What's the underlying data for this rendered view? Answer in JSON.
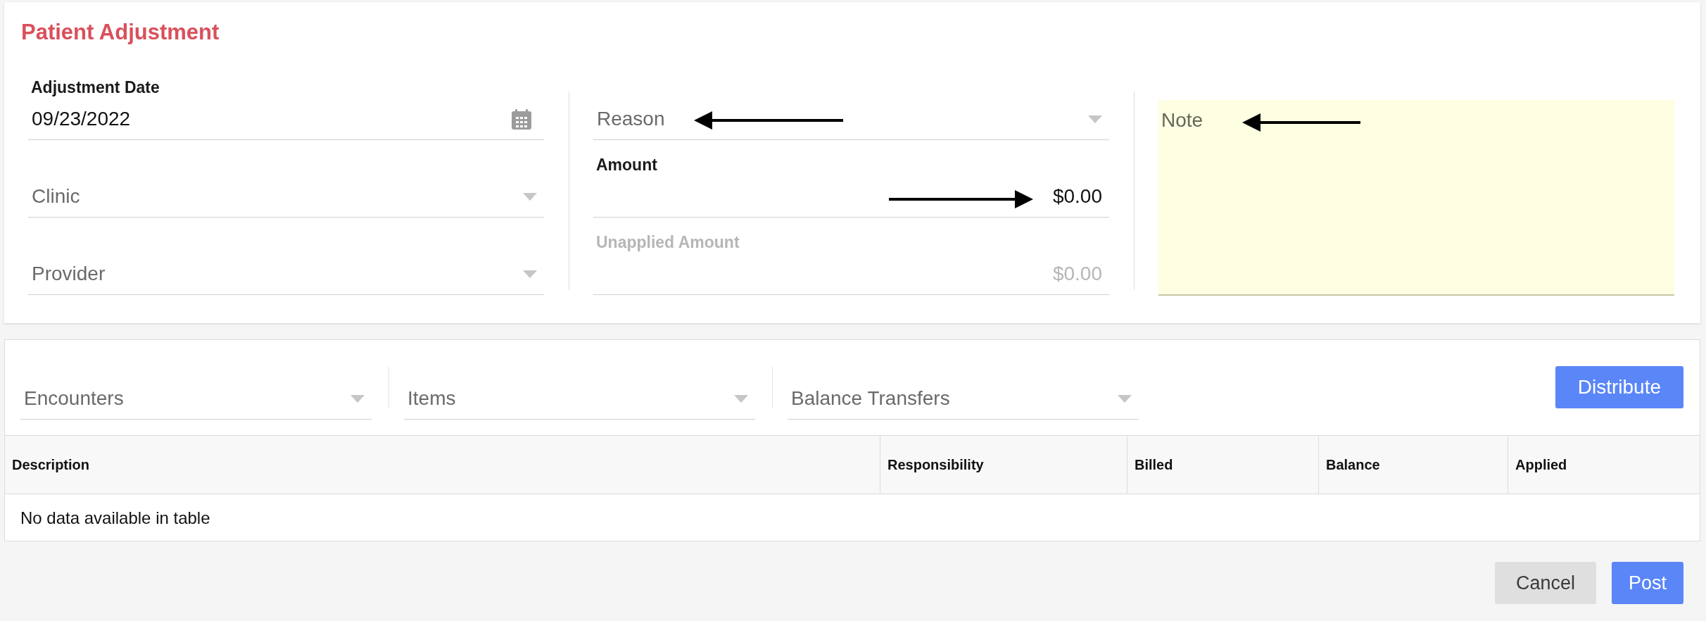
{
  "title": "Patient Adjustment",
  "form": {
    "columns": [
      {
        "fields": [
          {
            "kind": "date",
            "label": "Adjustment Date",
            "value": "09/23/2022",
            "disabled": false
          },
          {
            "kind": "select",
            "placeholder": "Clinic",
            "disabled": false
          },
          {
            "kind": "select",
            "placeholder": "Provider",
            "disabled": false
          }
        ]
      },
      {
        "fields": [
          {
            "kind": "select",
            "placeholder": "Reason",
            "disabled": false,
            "annotation_arrow": {
              "kind": "leftward"
            }
          },
          {
            "kind": "amount",
            "label": "Amount",
            "value": "$0.00",
            "disabled": false,
            "annotation_arrow": {
              "kind": "rightward"
            }
          },
          {
            "kind": "amount",
            "label": "Unapplied Amount",
            "value": "$0.00",
            "disabled": true
          }
        ]
      },
      {
        "fields": [
          {
            "kind": "note",
            "placeholder": "Note",
            "annotation_arrow": {
              "kind": "leftward"
            }
          }
        ]
      }
    ]
  },
  "filters": [
    {
      "placeholder": "Encounters"
    },
    {
      "placeholder": "Items"
    },
    {
      "placeholder": "Balance Transfers"
    }
  ],
  "distribute_button": {
    "label": "Distribute",
    "kind": "primary"
  },
  "table": {
    "columns": [
      "Description",
      "Responsibility",
      "Billed",
      "Balance",
      "Applied"
    ],
    "empty_message": "No data available in table"
  },
  "footer_buttons": [
    {
      "label": "Cancel",
      "kind": "secondary"
    },
    {
      "label": "Post",
      "kind": "primary"
    }
  ]
}
